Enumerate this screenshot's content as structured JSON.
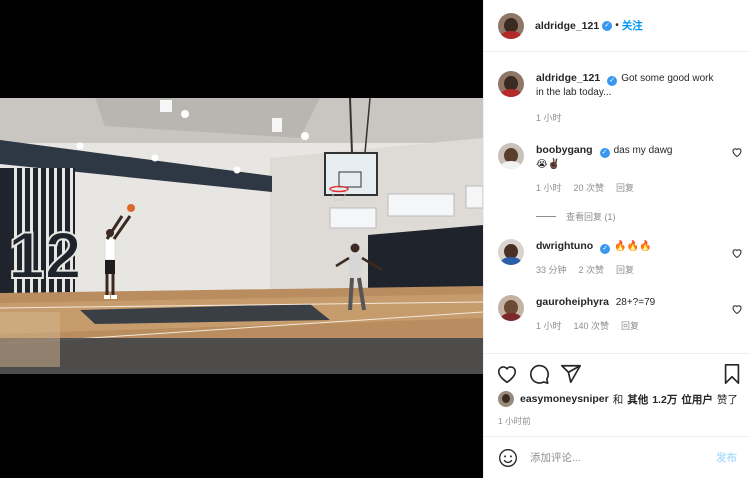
{
  "post": {
    "author": "aldridge_121",
    "follow_label": "关注",
    "separator": "•"
  },
  "caption": {
    "user": "aldridge_121",
    "text": "Got some good work in the lab today...",
    "time": "1 小时"
  },
  "comments": [
    {
      "user": "boobygang",
      "text": "das my dawg",
      "emoji": "😭✌🏿",
      "time": "1 小时",
      "likes": "20 次赞",
      "reply": "回复"
    },
    {
      "user": "dwrightuno",
      "text": "🔥🔥🔥",
      "time": "33 分钟",
      "likes": "2 次赞",
      "reply": "回复"
    },
    {
      "user": "gauroheiphyra",
      "text": "28+?=79",
      "time": "1 小时",
      "likes": "140 次赞",
      "reply": "回复"
    }
  ],
  "view_replies": "查看回复 (1)",
  "liked_by": {
    "user": "easymoneysniper",
    "and": "和",
    "others_prefix": "其他",
    "count": "1.2万",
    "suffix_bold": "位用户",
    "suffix": "赞了"
  },
  "post_time": "1 小时前",
  "add_comment": {
    "placeholder": "添加评论...",
    "post_label": "发布"
  },
  "photo": {
    "jersey_number": "12"
  },
  "colors": {
    "accent": "#0095f6",
    "verified": "#3897f0",
    "post_disabled": "#b2dffc",
    "fire": "#f0641e"
  }
}
